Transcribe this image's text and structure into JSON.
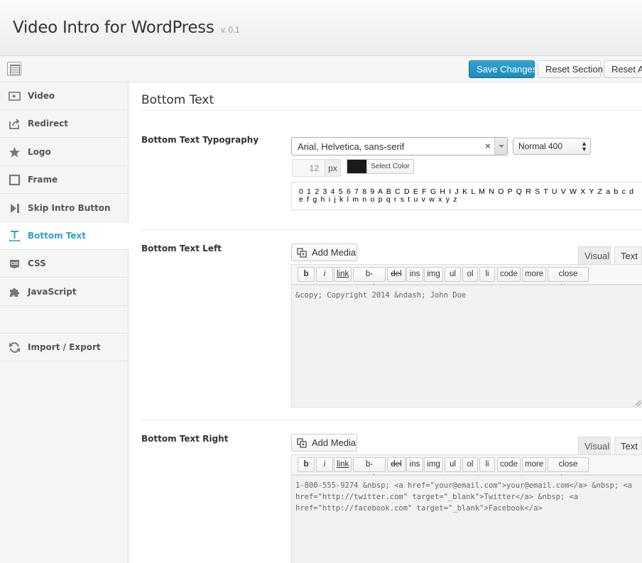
{
  "header": {
    "title": "Video Intro for WordPress",
    "version": "v. 0.1"
  },
  "toolbar": {
    "save_label": "Save Changes",
    "reset_section_label": "Reset Section",
    "reset_all_label": "Reset All"
  },
  "sidebar": {
    "items": [
      {
        "label": "Video",
        "icon": "play-icon"
      },
      {
        "label": "Redirect",
        "icon": "redirect-icon"
      },
      {
        "label": "Logo",
        "icon": "star-icon"
      },
      {
        "label": "Frame",
        "icon": "frame-icon"
      },
      {
        "label": "Skip Intro Button",
        "icon": "skip-icon"
      },
      {
        "label": "Bottom Text",
        "icon": "text-icon",
        "active": true
      },
      {
        "label": "CSS",
        "icon": "css-icon"
      },
      {
        "label": "JavaScript",
        "icon": "puzzle-icon"
      },
      {
        "label": "Import / Export",
        "icon": "refresh-icon"
      }
    ],
    "active_color": "#2ea2cc"
  },
  "main": {
    "section_title": "Bottom Text",
    "typography": {
      "label": "Bottom Text Typography",
      "font_family": "Arial, Helvetica, sans-serif",
      "font_clear": "×",
      "font_weight": "Normal 400",
      "font_size": "12",
      "font_unit": "px",
      "color": "#1a1a1a",
      "select_color_label": "Select Color",
      "preview": "0 1 2 3 4 5 6 7 8 9 A B C D E F G H I J K L M N O P Q R S T U V W X Y Z a b c d e f g h i j k l m n o p q r s t u v w x y z"
    },
    "left": {
      "label": "Bottom Text Left",
      "add_media": "Add Media",
      "tab_visual": "Visual",
      "tab_text": "Text",
      "content": "&copy; Copyright 2014 &ndash; John Doe"
    },
    "right": {
      "label": "Bottom Text Right",
      "add_media": "Add Media",
      "tab_visual": "Visual",
      "tab_text": "Text",
      "content": "1-800-555-9274 &nbsp; <a href=\"your@email.com\">your@email.com</a> &nbsp; <a href=\"http://twitter.com\" target=\"_blank\">Twitter</a> &nbsp; <a href=\"http://facebook.com\" target=\"_blank\">Facebook</a>"
    },
    "quicktags": [
      "b",
      "i",
      "link",
      "b-quote",
      "del",
      "ins",
      "img",
      "ul",
      "ol",
      "li",
      "code",
      "more",
      "close tags"
    ]
  }
}
